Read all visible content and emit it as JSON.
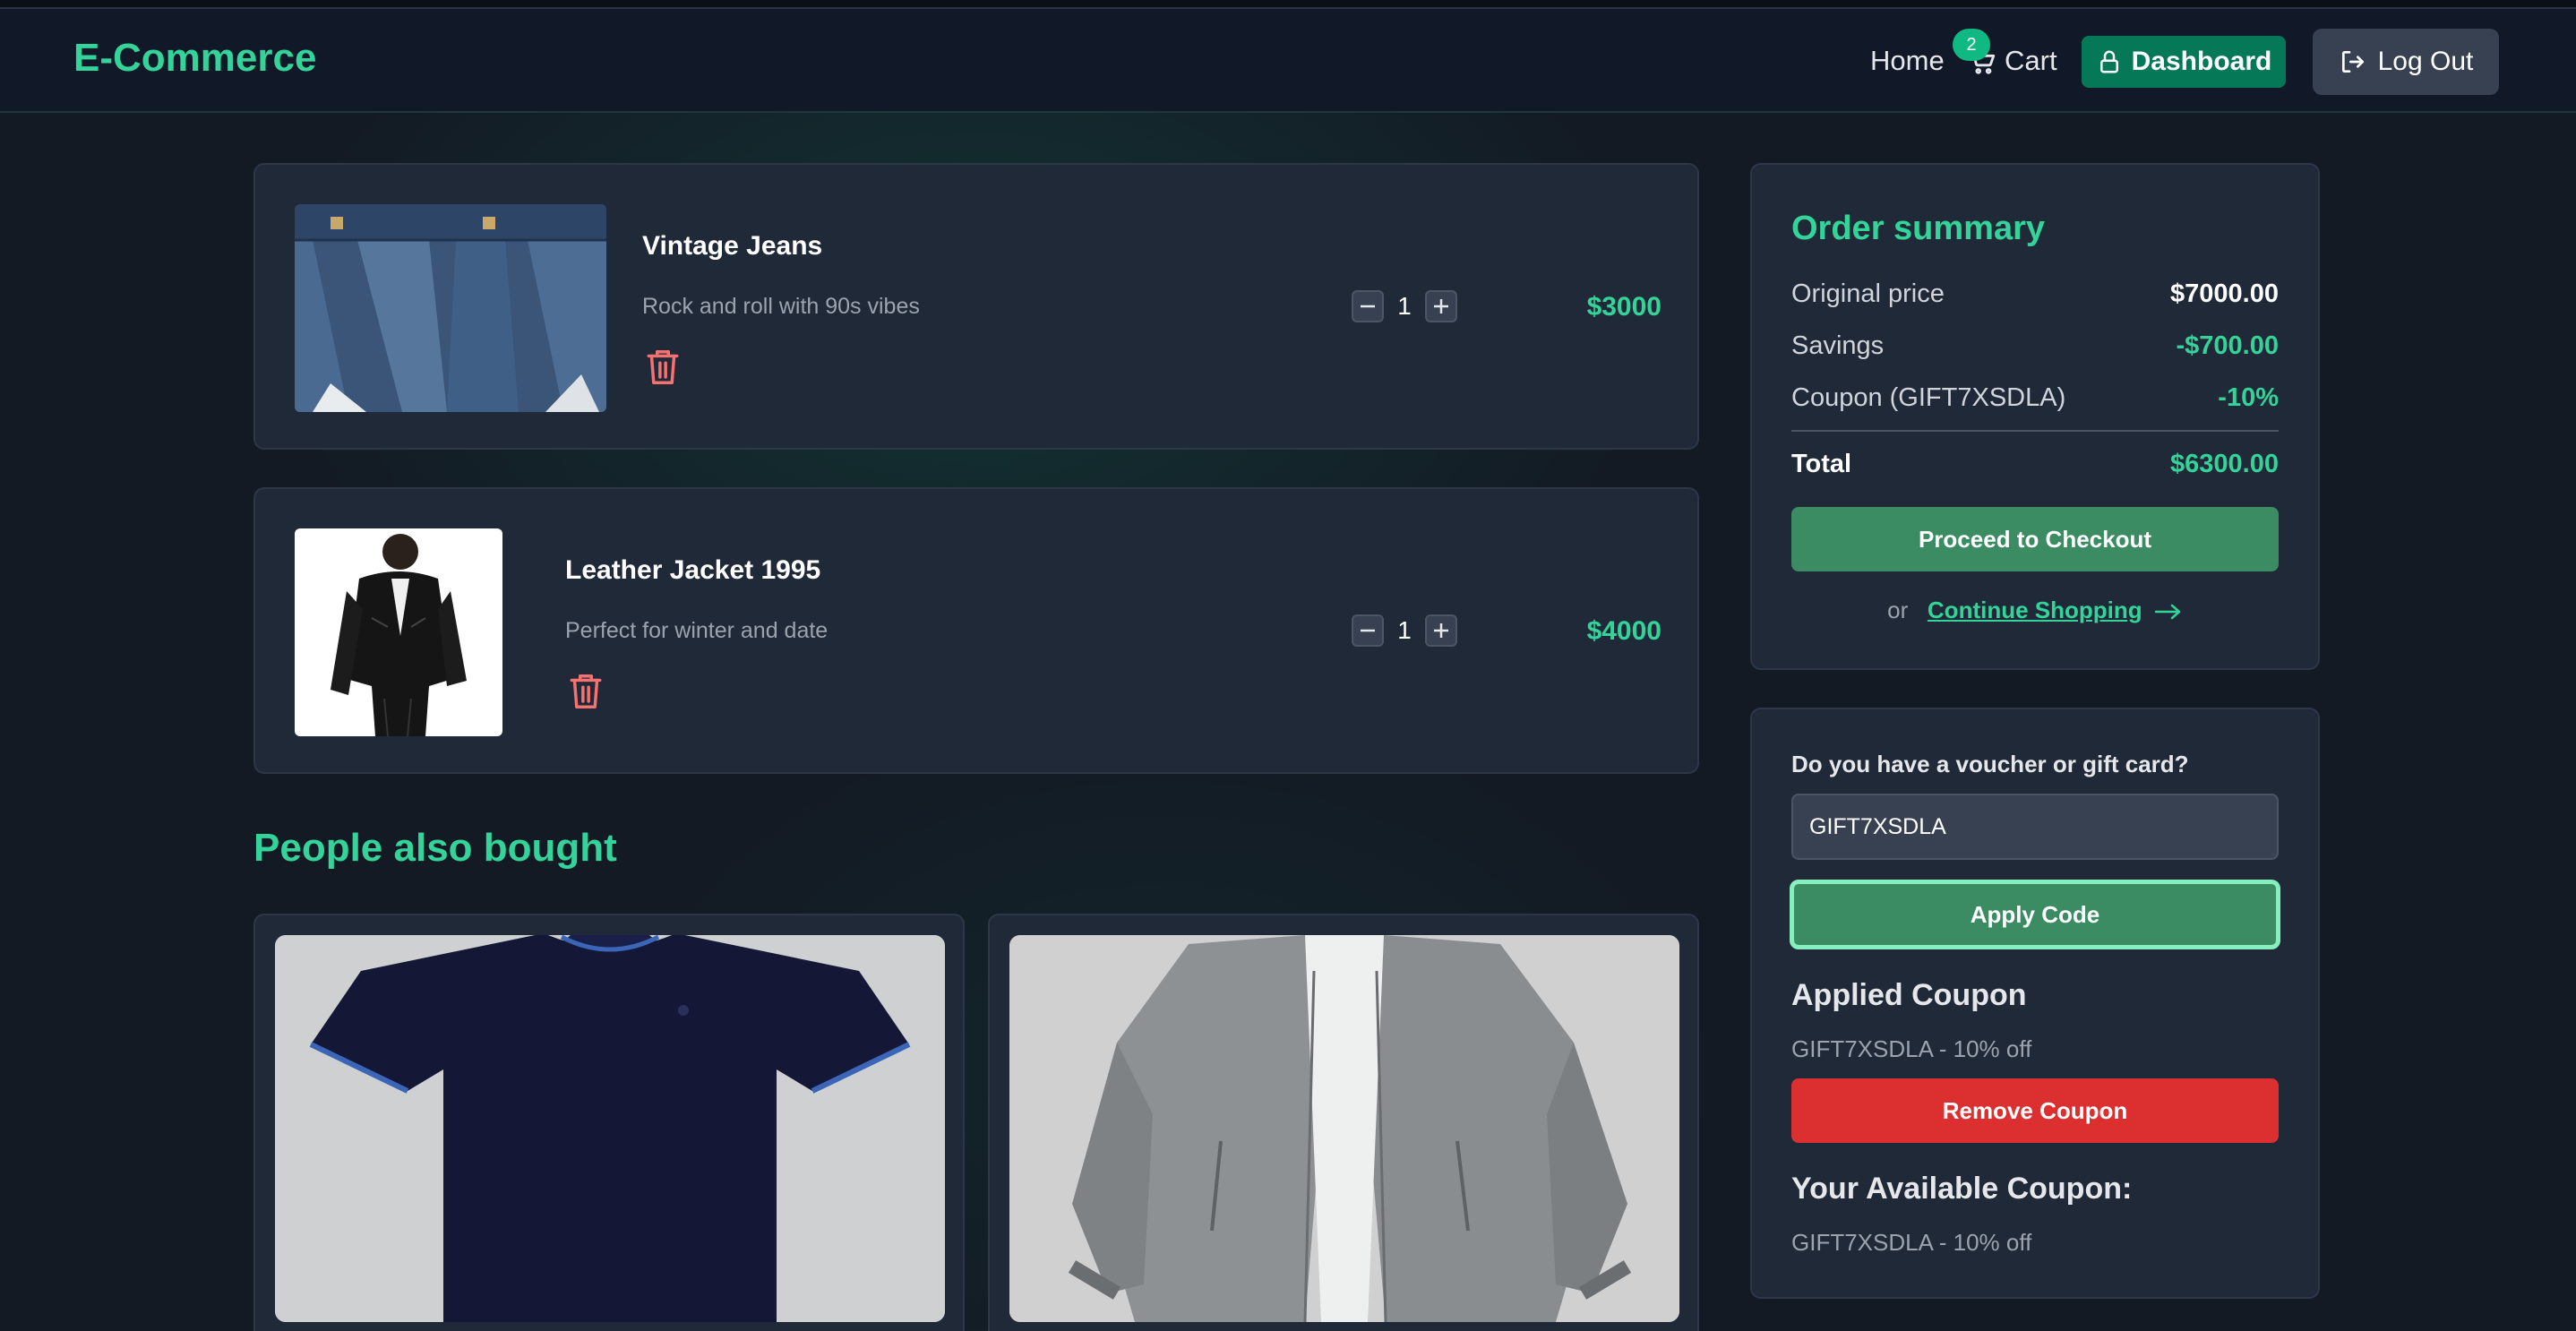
{
  "header": {
    "brand": "E-Commerce",
    "nav": {
      "home": "Home",
      "cart": "Cart",
      "cart_count": "2",
      "dashboard": "Dashboard",
      "logout": "Log Out"
    }
  },
  "cart": {
    "items": [
      {
        "name": "Vintage Jeans",
        "description": "Rock and roll with 90s vibes",
        "quantity": "1",
        "price": "$3000"
      },
      {
        "name": "Leather Jacket 1995",
        "description": "Perfect for winter and date",
        "quantity": "1",
        "price": "$4000"
      }
    ]
  },
  "recommendations": {
    "title": "People also bought"
  },
  "summary": {
    "title": "Order summary",
    "original_label": "Original price",
    "original_value": "$7000.00",
    "savings_label": "Savings",
    "savings_value": "-$700.00",
    "coupon_label": "Coupon (GIFT7XSDLA)",
    "coupon_value": "-10%",
    "total_label": "Total",
    "total_value": "$6300.00",
    "checkout_label": "Proceed to Checkout",
    "or_text": "or",
    "continue_label": "Continue Shopping"
  },
  "voucher": {
    "question": "Do you have a voucher or gift card?",
    "input_value": "GIFT7XSDLA",
    "apply_label": "Apply Code",
    "applied_title": "Applied Coupon",
    "applied_text": "GIFT7XSDLA - 10% off",
    "remove_label": "Remove Coupon",
    "available_title": "Your Available Coupon:",
    "available_text": "GIFT7XSDLA - 10% off"
  },
  "colors": {
    "accent": "#34d399",
    "button_green": "#3c8c63",
    "danger": "#dc2f2f",
    "background": "#131a24",
    "card": "#1f2937"
  }
}
